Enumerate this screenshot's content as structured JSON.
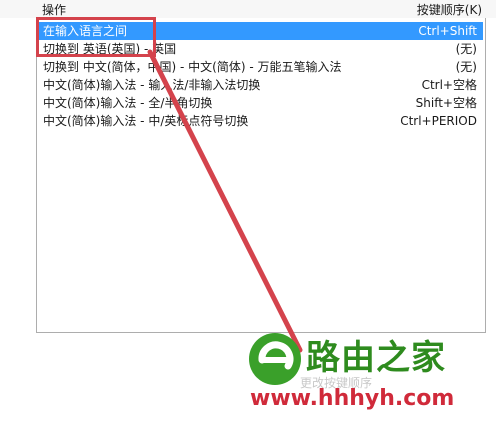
{
  "header": {
    "action_label": "操作",
    "keys_label": "按键顺序(K)"
  },
  "list": {
    "rows": [
      {
        "action": "在输入语言之间",
        "keys": "Ctrl+Shift",
        "selected": true
      },
      {
        "action": "切换到 英语(英国) - 英国",
        "keys": "(无)",
        "selected": false
      },
      {
        "action": "切换到 中文(简体，中国) - 中文(简体) - 万能五笔输入法",
        "keys": "(无)",
        "selected": false
      },
      {
        "action": "中文(简体)输入法 - 输入法/非输入法切换",
        "keys": "Ctrl+空格",
        "selected": false
      },
      {
        "action": "中文(简体)输入法 - 全/半角切换",
        "keys": "Shift+空格",
        "selected": false
      },
      {
        "action": "中文(简体)输入法 - 中/英标点符号切换",
        "keys": "Ctrl+PERIOD",
        "selected": false
      }
    ]
  },
  "annotation": {
    "highlight_color": "#d4434c",
    "arrow_color": "#d4434c"
  },
  "footer_ghost": "更改按键顺序",
  "watermark": {
    "brand": "路由之家",
    "url": "www.hhhyh.com",
    "brand_color": "#2e8b1e",
    "url_color": "#d02a3a"
  },
  "selected_color": "#3399ff"
}
